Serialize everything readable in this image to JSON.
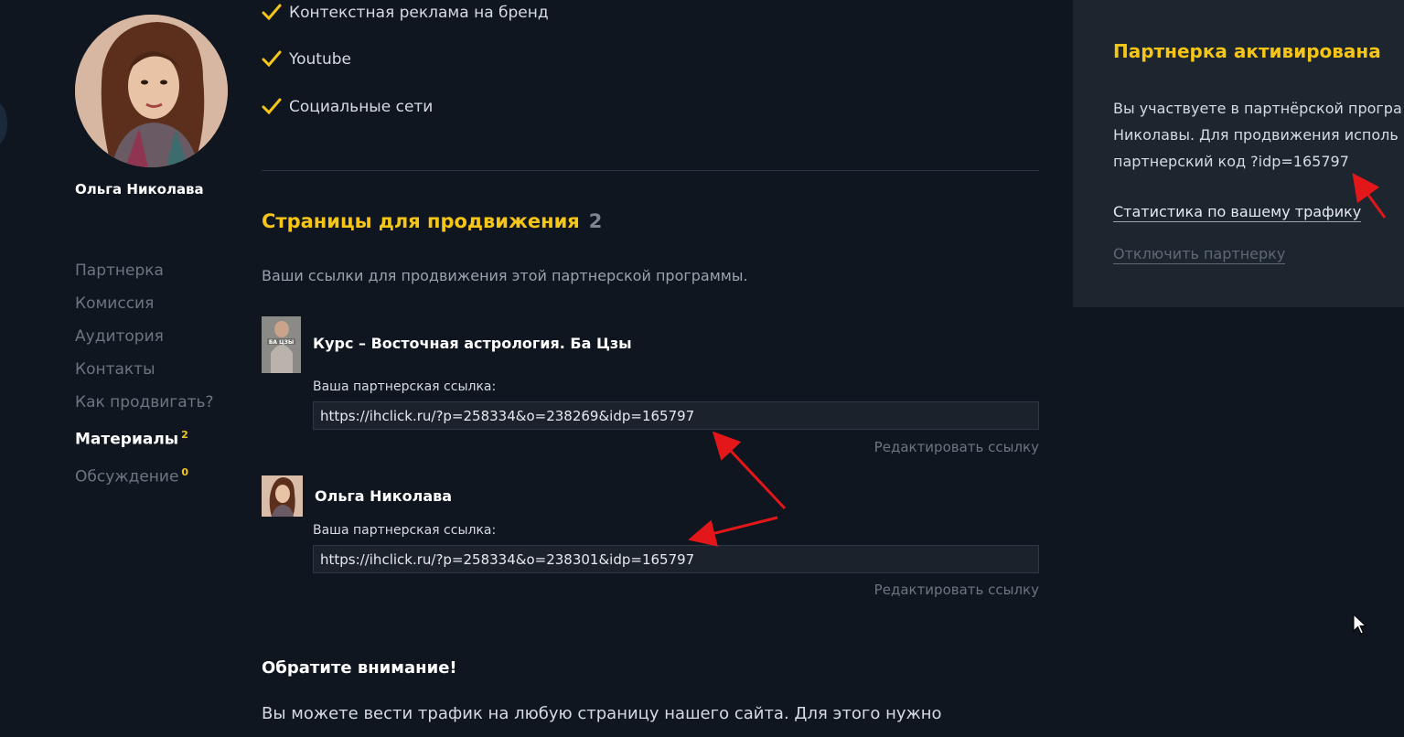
{
  "profile": {
    "name": "Ольга Николава"
  },
  "sidebar": {
    "items": [
      {
        "label": "Партнерка",
        "active": false
      },
      {
        "label": "Комиссия",
        "active": false
      },
      {
        "label": "Аудитория",
        "active": false
      },
      {
        "label": "Контакты",
        "active": false
      },
      {
        "label": "Как продвигать?",
        "active": false
      },
      {
        "label": "Материалы",
        "active": true,
        "badge": "2"
      },
      {
        "label": "Обсуждение",
        "active": false,
        "badge": "0"
      }
    ]
  },
  "channels": [
    "Контекстная реклама на бренд",
    "Youtube",
    "Социальные сети"
  ],
  "promo_section": {
    "title": "Страницы для продвижения",
    "count": "2",
    "description": "Ваши ссылки для продвижения этой партнерской программы."
  },
  "promo_items": [
    {
      "title": "Курс – Восточная астрология. Ба Цзы",
      "link_label": "Ваша партнерская ссылка:",
      "link": "https://ihclick.ru/?p=258334&o=238269&idp=165797",
      "edit_label": "Редактировать ссылку",
      "thumb_text": "БА ЦЗЫ"
    },
    {
      "title": "Ольга Николава",
      "link_label": "Ваша партнерская ссылка:",
      "link": "https://ihclick.ru/?p=258334&o=238301&idp=165797",
      "edit_label": "Редактировать ссылку"
    }
  ],
  "notice": {
    "title": "Обратите внимание!",
    "text": "Вы можете вести трафик на любую страницу нашего сайта. Для этого нужно"
  },
  "right_panel": {
    "title": "Партнерка активирована",
    "text_lines": [
      "Вы участвуете в партнёрской програ",
      "Николавы. Для продвижения исполь",
      "партнерский код ?idp=165797"
    ],
    "stats_link": "Статистика по вашему трафику",
    "disable_link": "Отключить партнерку"
  },
  "colors": {
    "background": "#0f161f",
    "accent": "#f5c518",
    "panel": "#1d252f",
    "arrow": "#e3161a"
  }
}
